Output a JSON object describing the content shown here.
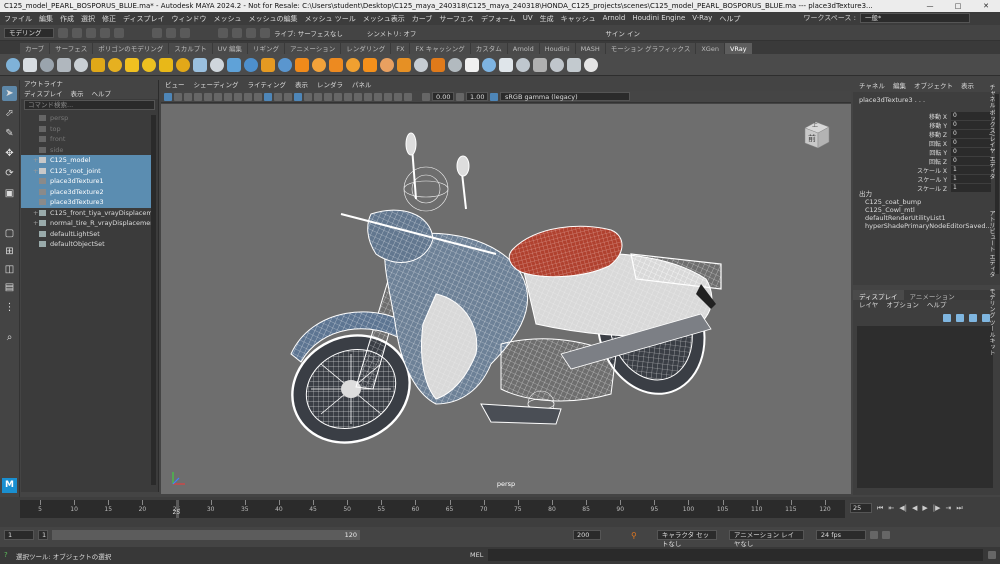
{
  "window": {
    "title": "C125_model_PEARL_BOSPORUS_BLUE.ma* - Autodesk MAYA 2024.2 - Not for Resale: C:\\Users\\student\\Desktop\\C125_maya_240318\\C125_maya_240318\\HONDA_C125_projects\\scenes\\C125_model_PEARL_BOSPORUS_BLUE.ma  ---  place3dTexture3...",
    "minimize": "—",
    "maximize": "□",
    "close": "✕"
  },
  "menubar": {
    "items": [
      "ファイル",
      "編集",
      "作成",
      "選択",
      "修正",
      "ディスプレイ",
      "ウィンドウ",
      "メッシュ",
      "メッシュの編集",
      "メッシュ ツール",
      "メッシュ表示",
      "カーブ",
      "サーフェス",
      "デフォーム",
      "UV",
      "生成",
      "キャッシュ",
      "Arnold",
      "Houdini Engine",
      "V-Ray",
      "ヘルプ"
    ],
    "workspace_label": "ワークスペース :",
    "workspace_value": "一般*"
  },
  "statusline": {
    "mode": "モデリング",
    "live": "ライブ: サーフェスなし",
    "symmetry": "シンメトリ: オフ",
    "signin": "サイン イン"
  },
  "shelf_tabs": [
    "カーブ",
    "サーフェス",
    "ポリゴンのモデリング",
    "スカルプト",
    "UV 編集",
    "リギング",
    "アニメーション",
    "レンダリング",
    "FX",
    "FX キャッシング",
    "カスタム",
    "Arnold",
    "Houdini",
    "MASH",
    "モーション グラフィックス",
    "XGen",
    "VRay"
  ],
  "shelf_active": "VRay",
  "shelf_icons": [
    "#7fb2d8",
    "#d8dde2",
    "#9aa4ad",
    "#b0b7be",
    "#c9cfd4",
    "#e0a818",
    "#e6b020",
    "#f0c020",
    "#ecc020",
    "#e8b818",
    "#e2a818",
    "#9ac0df",
    "#cfd6dc",
    "#5fa2d8",
    "#4d8fcc",
    "#e59a22",
    "#5a96cf",
    "#f08a1a",
    "#f2a23a",
    "#ed8a20",
    "#f0a030",
    "#f5901a",
    "#e8a060",
    "#e69024",
    "#c6ccd2",
    "#e07a1a",
    "#b2babf",
    "#f0f0f0",
    "#7eb4e2",
    "#dfe5ea",
    "#bfc7ce",
    "#b0b0b0",
    "#c0c6cc",
    "#c3cacf",
    "#e4e4e4"
  ],
  "outliner": {
    "title": "アウトライナ",
    "menu": [
      "ディスプレイ",
      "表示",
      "ヘルプ"
    ],
    "search_placeholder": "コマンド検索...",
    "items": [
      {
        "label": "persp",
        "style": "dim"
      },
      {
        "label": "top",
        "style": "dim"
      },
      {
        "label": "front",
        "style": "dim"
      },
      {
        "label": "side",
        "style": "dim"
      },
      {
        "label": "C125_model",
        "style": "sel",
        "exp": "+"
      },
      {
        "label": "C125_root_joint",
        "style": "sel",
        "exp": "+"
      },
      {
        "label": "place3dTexture1",
        "style": "sel"
      },
      {
        "label": "place3dTexture2",
        "style": "sel"
      },
      {
        "label": "place3dTexture3",
        "style": "sel"
      },
      {
        "label": "C125_front_tiya_vrayDisplaceme",
        "style": "",
        "exp": "+"
      },
      {
        "label": "normal_tire_R_vrayDisplacemen",
        "style": "",
        "exp": "+"
      },
      {
        "label": "defaultLightSet",
        "style": ""
      },
      {
        "label": "defaultObjectSet",
        "style": ""
      }
    ]
  },
  "viewport": {
    "menu": [
      "ビュー",
      "シェーディング",
      "ライティング",
      "表示",
      "レンダラ",
      "パネル"
    ],
    "exposure": "0.00",
    "gamma": "1.00",
    "colorspace": "sRGB gamma (legacy)",
    "label": "persp",
    "cube_label": "前",
    "cube_top": "上"
  },
  "channelbox": {
    "menu": [
      "チャネル",
      "編集",
      "オブジェクト",
      "表示"
    ],
    "object": "place3dTexture3 . . .",
    "attrs": [
      {
        "label": "移動 X",
        "value": "0"
      },
      {
        "label": "移動 Y",
        "value": "0"
      },
      {
        "label": "移動 Z",
        "value": "0"
      },
      {
        "label": "回転 X",
        "value": "0"
      },
      {
        "label": "回転 Y",
        "value": "0"
      },
      {
        "label": "回転 Z",
        "value": "0"
      },
      {
        "label": "スケール X",
        "value": "1"
      },
      {
        "label": "スケール Y",
        "value": "1"
      },
      {
        "label": "スケール Z",
        "value": "1"
      }
    ],
    "outputs_label": "出力",
    "outputs": [
      "C125_coat_bump",
      "C125_Cowl_mtl",
      "defaultRenderUtilityList1",
      "hyperShadePrimaryNodeEditorSaved..."
    ]
  },
  "sidetabs": [
    "チャネル ボックス/レイヤ エディタ",
    "アトリビュート エディタ",
    "モデリング ツールキット"
  ],
  "layers": {
    "tabs": [
      "ディスプレイ",
      "アニメーション"
    ],
    "menu": [
      "レイヤ",
      "オプション",
      "ヘルプ"
    ]
  },
  "timeline": {
    "ticks": [
      "5",
      "10",
      "15",
      "20",
      "25",
      "30",
      "35",
      "40",
      "45",
      "50",
      "55",
      "60",
      "65",
      "70",
      "75",
      "80",
      "85",
      "90",
      "95",
      "100",
      "105",
      "110",
      "115",
      "120"
    ],
    "current": "25",
    "current_field": "25"
  },
  "range": {
    "start": "1",
    "inner_start": "1",
    "inner_end": "120",
    "end": "200",
    "character": "キャラクタ セットなし",
    "anim_layer": "アニメーション レイヤなし",
    "fps": "24 fps"
  },
  "command": {
    "help": "選択ツール: オブジェクトの選択",
    "mel": "MEL"
  }
}
